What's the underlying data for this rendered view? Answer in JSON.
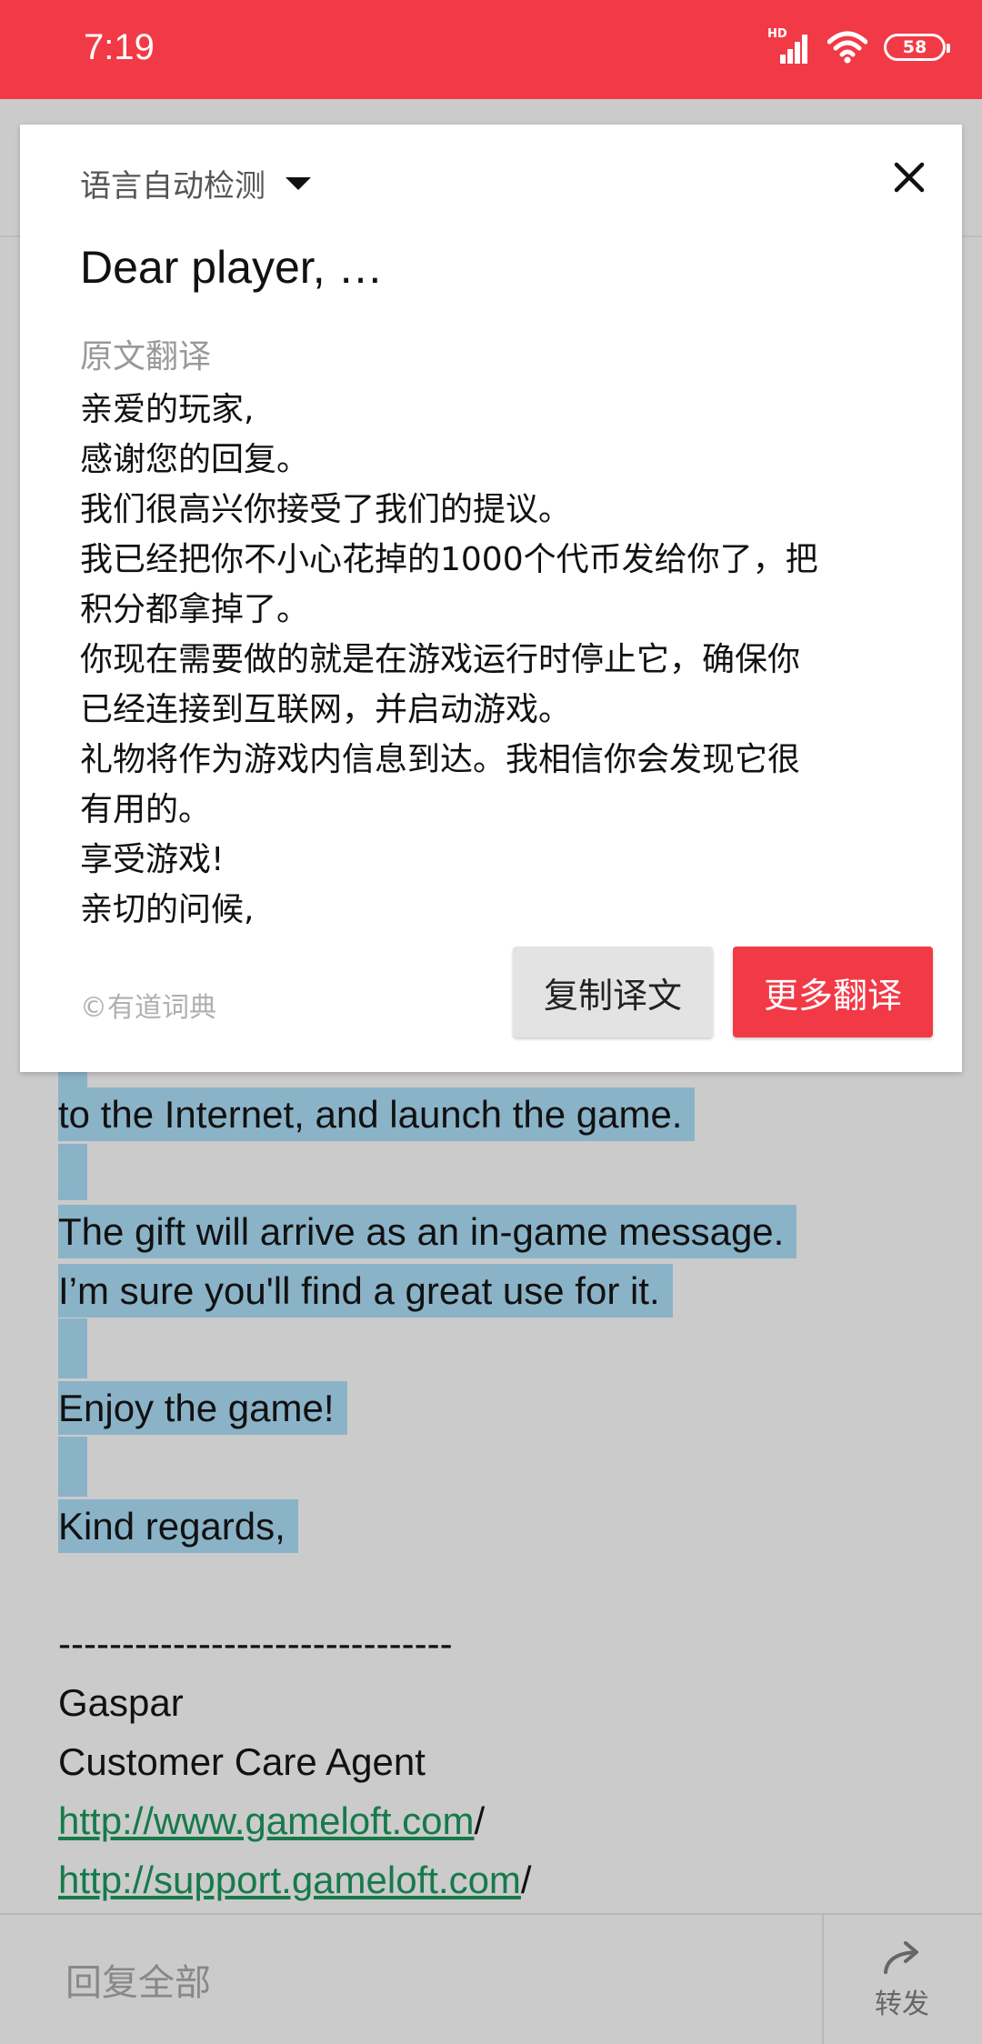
{
  "status_bar": {
    "time": "7:19",
    "signal_label": "HD",
    "battery": "58"
  },
  "email": {
    "lines": [
      "to the Internet, and launch the game.",
      "The gift will arrive as an in-game message.",
      "I’m sure you'll find a great use for it.",
      "Enjoy the game!",
      "Kind regards,",
      "-------------------------------",
      "Gaspar",
      "Customer Care Agent"
    ],
    "link1": "http://www.gameloft.com",
    "link1_suffix": "/",
    "link2": "http://support.gameloft.com",
    "link2_suffix": "/"
  },
  "dialog": {
    "language_label": "语言自动检测",
    "source_text": "Dear  player,  …",
    "section_label": "原文翻译",
    "translation_lines": [
      "亲爱的玩家,",
      "感谢您的回复。",
      "我们很高兴你接受了我们的提议。",
      "我已经把你不小心花掉的1000个代币发给你了，把",
      "积分都拿掉了。",
      "你现在需要做的就是在游戏运行时停止它，确保你",
      "已经连接到互联网，并启动游戏。",
      "礼物将作为游戏内信息到达。我相信你会发现它很",
      "有用的。",
      "享受游戏!",
      "亲切的问候,"
    ],
    "credit": "©有道词典",
    "copy_button": "复制译文",
    "more_button": "更多翻译"
  },
  "bottom_bar": {
    "reply_all": "回复全部",
    "forward": "转发"
  },
  "colors": {
    "accent": "#f23a46",
    "highlight": "#8bb3c8",
    "link": "#167a4a"
  }
}
